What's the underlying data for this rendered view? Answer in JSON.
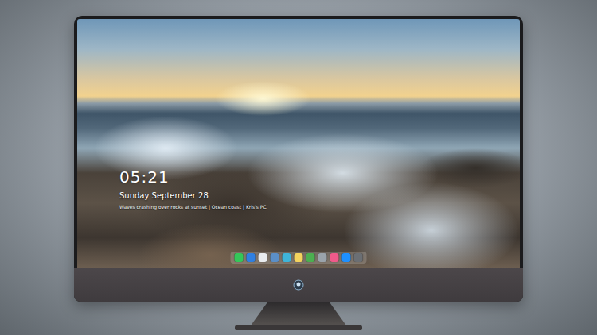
{
  "lock_screen": {
    "time": "05:21",
    "date": "Sunday September 28",
    "caption": "Waves crashing over rocks at sunset  |  Ocean coast  |  Kris's PC"
  },
  "dock": {
    "apps": [
      {
        "color": "#34c759"
      },
      {
        "color": "#2f7fe0"
      },
      {
        "color": "#e9ecef"
      },
      {
        "color": "#5b8fc7"
      },
      {
        "color": "#3fb4d8"
      },
      {
        "color": "#f4d35e"
      },
      {
        "color": "#4caf50"
      },
      {
        "color": "#9aa3ab"
      },
      {
        "color": "#f05a8a"
      },
      {
        "color": "#1e90ff"
      },
      {
        "color": "#6b6f74"
      }
    ]
  }
}
